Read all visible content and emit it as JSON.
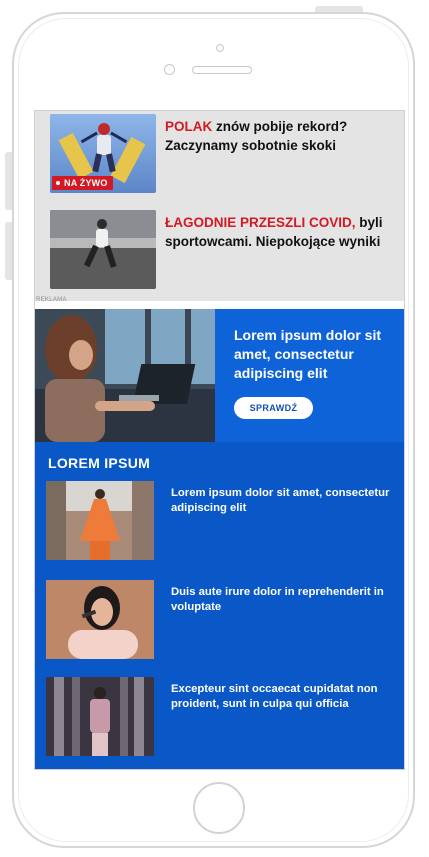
{
  "news": [
    {
      "highlight": "POLAK",
      "rest": " znów pobije rekord? Zaczynamy sobotnie skoki",
      "badge": "NA ŻYWO"
    },
    {
      "highlight": "ŁAGODNIE PRZESZLI COVID,",
      "rest": " byli sportowcami. Niepokojące wyniki"
    }
  ],
  "ad": {
    "label": "REKLAMA"
  },
  "hero": {
    "title": "Lorem ipsum dolor sit amet, consectetur adipiscing elit",
    "cta": "SPRAWDŹ"
  },
  "section": {
    "title": "LOREM IPSUM",
    "cards": [
      {
        "text": "Lorem ipsum dolor sit amet, consectetur adipiscing elit"
      },
      {
        "text": "Duis aute irure dolor in reprehenderit in voluptate"
      },
      {
        "text": "Excepteur sint occaecat cupidatat non proident, sunt in culpa qui officia"
      }
    ]
  },
  "colors": {
    "accent_red": "#d31a24",
    "hero_blue": "#0f63d8",
    "section_blue": "#0a58c8",
    "news_bg": "#e4e4e4"
  }
}
